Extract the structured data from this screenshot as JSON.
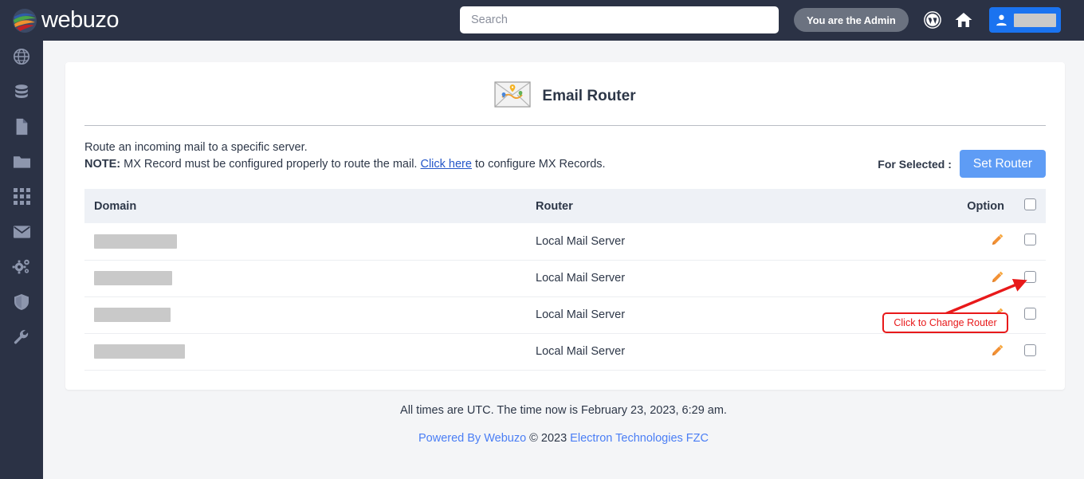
{
  "header": {
    "logo_text": "webuzo",
    "search_placeholder": "Search",
    "admin_badge": "You are the Admin",
    "wordpress_icon": "wordpress-icon",
    "home_icon": "home-icon",
    "user_icon": "user-icon",
    "username_redacted": ""
  },
  "sidebar": {
    "items": [
      {
        "icon": "globe-icon"
      },
      {
        "icon": "database-icon"
      },
      {
        "icon": "file-icon"
      },
      {
        "icon": "folder-icon"
      },
      {
        "icon": "grid-apps-icon"
      },
      {
        "icon": "envelope-icon"
      },
      {
        "icon": "gears-icon"
      },
      {
        "icon": "shield-icon"
      },
      {
        "icon": "wrench-icon"
      }
    ]
  },
  "page": {
    "title": "Email Router",
    "title_icon": "email-route-icon",
    "description": "Route an incoming mail to a specific server.",
    "note_label": "NOTE:",
    "note_before_link": " MX Record must be configured properly to route the mail. ",
    "note_link": "Click here",
    "note_after_link": " to configure MX Records.",
    "for_selected_label": "For Selected :",
    "set_router_button": "Set Router"
  },
  "table": {
    "columns": [
      "Domain",
      "Router",
      "Option"
    ],
    "select_all_checkbox": false,
    "rows": [
      {
        "domain_redacted_width": 104,
        "router": "Local Mail Server",
        "edit_icon": "pencil-icon",
        "checked": false
      },
      {
        "domain_redacted_width": 98,
        "router": "Local Mail Server",
        "edit_icon": "pencil-icon",
        "checked": false
      },
      {
        "domain_redacted_width": 96,
        "router": "Local Mail Server",
        "edit_icon": "pencil-icon",
        "checked": false
      },
      {
        "domain_redacted_width": 114,
        "router": "Local Mail Server",
        "edit_icon": "pencil-icon",
        "checked": false
      }
    ]
  },
  "annotation": {
    "text": "Click to Change Router",
    "color": "#e8191a"
  },
  "footer": {
    "time_line": "All times are UTC. The time now is February 23, 2023, 6:29 am.",
    "powered_by": "Powered By Webuzo",
    "copyright": " © 2023 ",
    "company": "Electron Technologies FZC"
  },
  "colors": {
    "topbar": "#2b3245",
    "accent_blue": "#1a73f0",
    "button_blue": "#5e9cf5",
    "pencil_orange": "#f29135",
    "annotation_red": "#e8191a"
  }
}
